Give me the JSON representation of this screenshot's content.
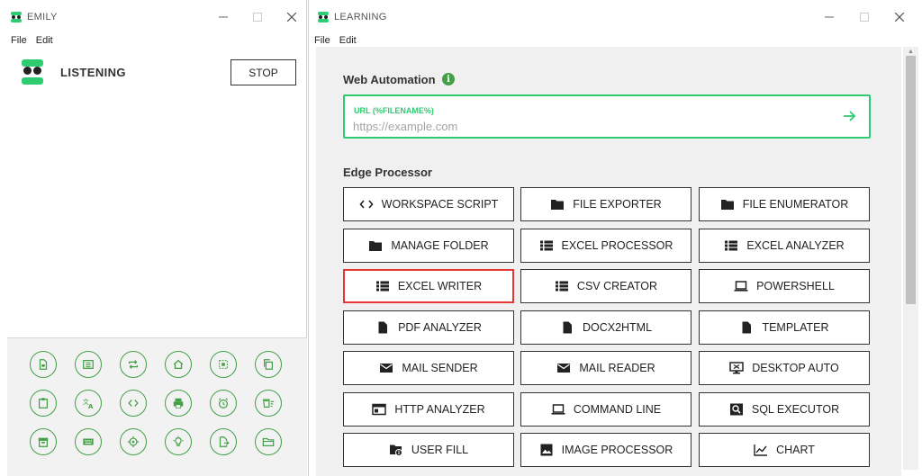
{
  "left_window": {
    "title": "EMILY",
    "menu": [
      "File",
      "Edit"
    ],
    "status_label": "LISTENING",
    "stop_label": "STOP",
    "tools": [
      "document-icon",
      "list-icon",
      "repeat-icon",
      "home-icon",
      "crop-icon",
      "copy-icon",
      "clipboard-icon",
      "translate-icon",
      "code-icon",
      "print-icon",
      "alarm-icon",
      "delete-sweep-icon",
      "archive-icon",
      "keyboard-icon",
      "target-icon",
      "lightbulb-icon",
      "export-icon",
      "folder-open-icon"
    ],
    "accent": "#43a047"
  },
  "right_window": {
    "title": "LEARNING",
    "menu": [
      "File",
      "Edit"
    ],
    "web_automation": {
      "title": "Web Automation",
      "info": "i",
      "url_label": "URL (%FILENAME%)",
      "url_placeholder": "https://example.com",
      "accent": "#2ecc71"
    },
    "edge_processor": {
      "title": "Edge Processor",
      "selected": "EXCEL WRITER",
      "selected_color": "#e53935",
      "buttons": [
        {
          "label": "WORKSPACE SCRIPT",
          "icon": "code-icon"
        },
        {
          "label": "FILE EXPORTER",
          "icon": "folder-icon"
        },
        {
          "label": "FILE ENUMERATOR",
          "icon": "folder-icon"
        },
        {
          "label": "MANAGE FOLDER",
          "icon": "folder-icon"
        },
        {
          "label": "EXCEL PROCESSOR",
          "icon": "list-icon"
        },
        {
          "label": "EXCEL ANALYZER",
          "icon": "list-icon"
        },
        {
          "label": "EXCEL WRITER",
          "icon": "list-icon"
        },
        {
          "label": "CSV CREATOR",
          "icon": "list-icon"
        },
        {
          "label": "POWERSHELL",
          "icon": "laptop-icon"
        },
        {
          "label": "PDF ANALYZER",
          "icon": "file-icon"
        },
        {
          "label": "DOCX2HTML",
          "icon": "file-icon"
        },
        {
          "label": "TEMPLATER",
          "icon": "file-icon"
        },
        {
          "label": "MAIL SENDER",
          "icon": "mail-icon"
        },
        {
          "label": "MAIL READER",
          "icon": "mail-icon"
        },
        {
          "label": "DESKTOP AUTO",
          "icon": "desktop-icon"
        },
        {
          "label": "HTTP ANALYZER",
          "icon": "browser-icon"
        },
        {
          "label": "COMMAND LINE",
          "icon": "laptop-icon"
        },
        {
          "label": "SQL EXECUTOR",
          "icon": "search-icon"
        },
        {
          "label": "USER FILL",
          "icon": "folder-info-icon"
        },
        {
          "label": "IMAGE PROCESSOR",
          "icon": "image-icon"
        },
        {
          "label": "CHART",
          "icon": "chart-icon"
        }
      ]
    }
  }
}
